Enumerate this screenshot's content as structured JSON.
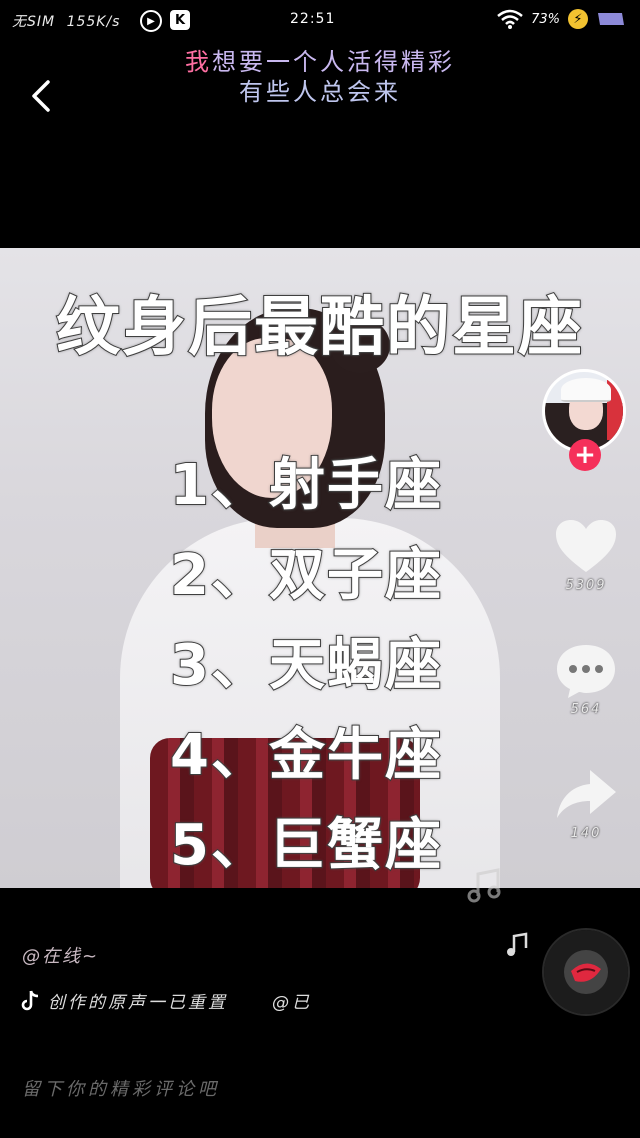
{
  "status_bar": {
    "carrier": "无SIM",
    "speed": "155K/s",
    "app_badge_1": "▶",
    "app_badge_2": "K",
    "time": "22:51",
    "battery": "73%",
    "wifi_icon": "wifi-icon",
    "charging_icon": "bolt-icon"
  },
  "header": {
    "back_icon": "chevron-left-icon",
    "lyric_line1_highlight": "我",
    "lyric_line1_rest": "想要一个人活得精彩",
    "lyric_line2": "有些人总会来"
  },
  "video": {
    "title": "纹身后最酷的星座",
    "list": [
      {
        "text": "1、射手座"
      },
      {
        "text": "2、双子座"
      },
      {
        "text": "3、天蝎座"
      },
      {
        "text": "4、金牛座"
      },
      {
        "text": "5、巨蟹座"
      }
    ]
  },
  "rail": {
    "follow_label": "+",
    "like_count": "5309",
    "comment_count": "564",
    "share_count": "140"
  },
  "info": {
    "author": "@在线~",
    "music_title": "创作的原声一已重置",
    "music_author": "@已"
  },
  "comment": {
    "placeholder": "留下你的精彩评论吧"
  },
  "colors": {
    "follow": "#f5305a",
    "lyric_highlight": "#ff6fa2",
    "lyric": "#c9b8ef"
  }
}
